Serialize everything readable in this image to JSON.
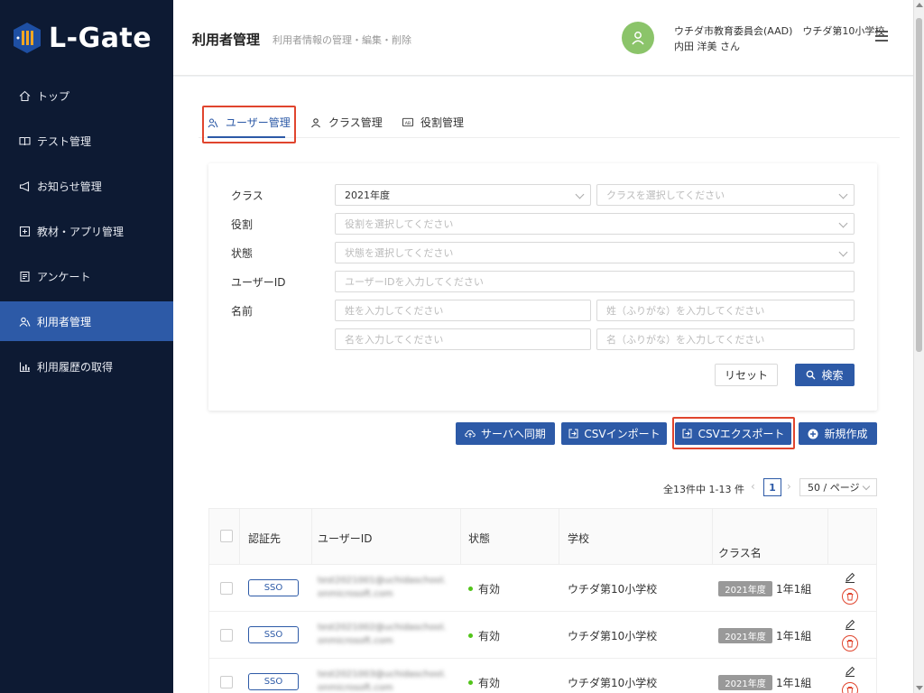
{
  "app": {
    "logo_text": "L-Gate"
  },
  "sidebar": {
    "items": [
      {
        "label": "トップ",
        "icon": "home-icon"
      },
      {
        "label": "テスト管理",
        "icon": "book-icon"
      },
      {
        "label": "お知らせ管理",
        "icon": "megaphone-icon"
      },
      {
        "label": "教材・アプリ管理",
        "icon": "plus-square-icon"
      },
      {
        "label": "アンケート",
        "icon": "survey-icon"
      },
      {
        "label": "利用者管理",
        "icon": "users-icon",
        "active": true
      },
      {
        "label": "利用履歴の取得",
        "icon": "bar-chart-icon"
      }
    ]
  },
  "header": {
    "title": "利用者管理",
    "subtitle": "利用者情報の管理・編集・削除",
    "user_org": "ウチダ市教育委員会(AAD)　ウチダ第10小学校",
    "user_name": "内田 洋美 さん"
  },
  "tabs": [
    {
      "label": "ユーザー管理",
      "active": true
    },
    {
      "label": "クラス管理"
    },
    {
      "label": "役割管理"
    }
  ],
  "filters": {
    "class_label": "クラス",
    "class_year_value": "2021年度",
    "class_placeholder": "クラスを選択してください",
    "role_label": "役割",
    "role_placeholder": "役割を選択してください",
    "status_label": "状態",
    "status_placeholder": "状態を選択してください",
    "userid_label": "ユーザーID",
    "userid_placeholder": "ユーザーIDを入力してください",
    "name_label": "名前",
    "last_name_placeholder": "姓を入力してください",
    "last_name_kana_placeholder": "姓（ふりがな）を入力してください",
    "first_name_placeholder": "名を入力してください",
    "first_name_kana_placeholder": "名（ふりがな）を入力してください",
    "reset_label": "リセット",
    "search_label": "検索"
  },
  "actions": {
    "sync_label": "サーバへ同期",
    "csv_import_label": "CSVインポート",
    "csv_export_label": "CSVエクスポート",
    "new_label": "新規作成"
  },
  "pagination": {
    "total_text": "全13件中 1-13 件",
    "current_page": "1",
    "page_size": "50 / ページ"
  },
  "table": {
    "headers": {
      "auth": "認証先",
      "user_id": "ユーザーID",
      "status": "状態",
      "school": "学校",
      "class": "クラス名"
    },
    "rows": [
      {
        "auth": "SSO",
        "uid_line1": "test2021001@uchidaschool.",
        "uid_line2": "onmicrosoft.com",
        "status": "有効",
        "school": "ウチダ第10小学校",
        "year": "2021年度",
        "class": "1年1組"
      },
      {
        "auth": "SSO",
        "uid_line1": "test2021002@uchidaschool.",
        "uid_line2": "onmicrosoft.com",
        "status": "有効",
        "school": "ウチダ第10小学校",
        "year": "2021年度",
        "class": "1年1組"
      },
      {
        "auth": "SSO",
        "uid_line1": "test2021003@uchidaschool.",
        "uid_line2": "onmicrosoft.com",
        "status": "有効",
        "school": "ウチダ第10小学校",
        "year": "2021年度",
        "class": "1年1組"
      }
    ]
  },
  "colors": {
    "sidebar_bg": "#0d1a33",
    "primary": "#2d5aa7",
    "highlight": "#e0452e",
    "avatar": "#8bc46a",
    "status_ok": "#52c41a"
  }
}
